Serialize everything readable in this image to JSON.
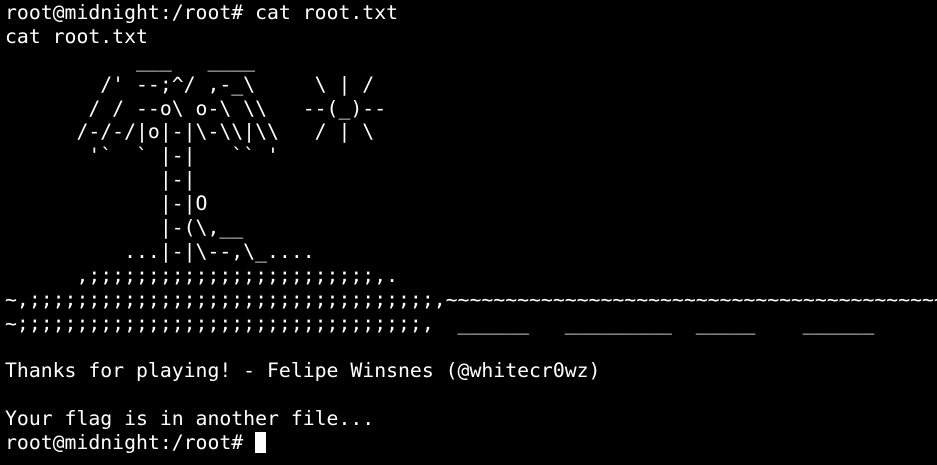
{
  "terminal": {
    "prompt": "root@midnight:/root# ",
    "command": "cat root.txt",
    "echo": "cat root.txt",
    "art": [
      "           ___   ____",
      "        /' --;^/ ,-_\\     \\ | /",
      "       / / --o\\ o-\\ \\\\   --(_)--",
      "      /-/-/|o|-|\\-\\\\|\\\\   / | \\",
      "       '`  ` |-|   `` '",
      "             |-|",
      "             |-|O",
      "             |-(\\,__",
      "          ...|-|\\--,\\_....",
      "      ,;;;;;;;;;;;;;;;;;;;;;;;;,.",
      "~,;;;;;;;;;;;;;;;;;;;;;;;;;;;;;;;;;;,~~~~~~~~~~~~~~~~~~~~~~~~~~~~~~~~~~~~~~~~~~~~~",
      "~;;;;;;;;;;;;;;;;;;;;;;;;;;;;;;;;;;,  ______   _________  _____    ______"
    ],
    "thanks": "Thanks for playing! - Felipe Winsnes (@whitecr0wz)",
    "flag_note": "Your flag is in another file...",
    "final_prompt": "root@midnight:/root# "
  },
  "colors": {
    "background": "#000000",
    "foreground": "#ffffff"
  }
}
